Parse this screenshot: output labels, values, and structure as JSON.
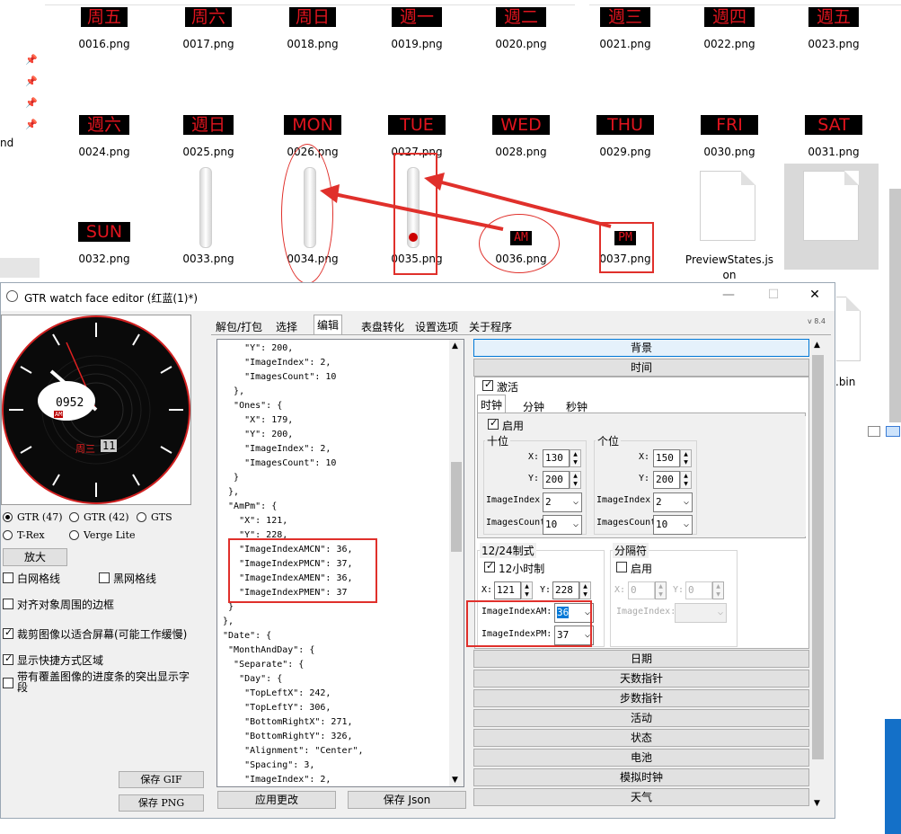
{
  "explorer": {
    "row1": [
      {
        "img": "周五",
        "file": "0016.png"
      },
      {
        "img": "周六",
        "file": "0017.png"
      },
      {
        "img": "周日",
        "file": "0018.png"
      },
      {
        "img": "週一",
        "file": "0019.png"
      },
      {
        "img": "週二",
        "file": "0020.png"
      },
      {
        "img": "週三",
        "file": "0021.png"
      },
      {
        "img": "週四",
        "file": "0022.png"
      },
      {
        "img": "週五",
        "file": "0023.png"
      }
    ],
    "row2": [
      {
        "img": "週六",
        "file": "0024.png"
      },
      {
        "img": "週日",
        "file": "0025.png"
      },
      {
        "img": "MON",
        "file": "0026.png"
      },
      {
        "img": "TUE",
        "file": "0027.png"
      },
      {
        "img": "WED",
        "file": "0028.png"
      },
      {
        "img": "THU",
        "file": "0029.png"
      },
      {
        "img": "FRI",
        "file": "0030.png"
      },
      {
        "img": "SAT",
        "file": "0031.png"
      }
    ],
    "row3": [
      {
        "img": "SUN",
        "file": "0032.png"
      },
      {
        "img": "",
        "file": "0033.png"
      },
      {
        "img": "",
        "file": "0034.png"
      },
      {
        "img": "",
        "file": "0035.png"
      },
      {
        "img": "AM",
        "file": "0036.png"
      },
      {
        "img": "PM",
        "file": "0037.png"
      },
      {
        "img": "",
        "file": "PreviewStates.json"
      },
      {
        "img": "",
        "file": "红蓝(1).json"
      }
    ],
    "left_edge_text": "nd",
    "partial_file": ".bin"
  },
  "window": {
    "title": "GTR watch face editor (红蓝(1)*)",
    "controls": {
      "min": "—",
      "max": "☐",
      "close": "✕"
    },
    "version": "v 8.4"
  },
  "preview": {
    "time": "0952",
    "ampm": "AM",
    "weekday": "周三",
    "day": "11"
  },
  "left": {
    "models": [
      "GTR (47)",
      "GTR (42)",
      "GTS",
      "T-Rex",
      "Verge Lite"
    ],
    "zoom_button": "放大",
    "checks": [
      {
        "label": "白网格线",
        "checked": false
      },
      {
        "label": "黑网格线",
        "checked": false
      },
      {
        "label": "对齐对象周围的边框",
        "checked": false
      },
      {
        "label": "裁剪图像以适合屏幕(可能工作缓慢)",
        "checked": true
      },
      {
        "label": "显示快捷方式区域",
        "checked": true
      },
      {
        "label": "带有覆盖图像的进度条的突出显示字段",
        "checked": false
      }
    ],
    "save_gif": "保存 GIF",
    "save_png": "保存 PNG"
  },
  "tabs": [
    "解包/打包",
    "选择",
    "编辑",
    "表盘转化",
    "设置选项",
    "关于程序"
  ],
  "json_text": "     \"Y\": 200,\n     \"ImageIndex\": 2,\n     \"ImagesCount\": 10\n   },\n   \"Ones\": {\n     \"X\": 179,\n     \"Y\": 200,\n     \"ImageIndex\": 2,\n     \"ImagesCount\": 10\n   }\n  },\n  \"AmPm\": {\n    \"X\": 121,\n    \"Y\": 228,\n    \"ImageIndexAMCN\": 36,\n    \"ImageIndexPMCN\": 37,\n    \"ImageIndexAMEN\": 36,\n    \"ImageIndexPMEN\": 37\n  }\n },\n \"Date\": {\n  \"MonthAndDay\": {\n   \"Separate\": {\n    \"Day\": {\n     \"TopLeftX\": 242,\n     \"TopLeftY\": 306,\n     \"BottomRightX\": 271,\n     \"BottomRightY\": 326,\n     \"Alignment\": \"Center\",\n     \"Spacing\": 3,\n     \"ImageIndex\": 2,",
  "apply_button": "应用更改",
  "save_json_button": "保存 Json",
  "sections": {
    "background": "背景",
    "time": "时间",
    "date": "日期",
    "days_pointer": "天数指针",
    "steps_pointer": "步数指针",
    "activity": "活动",
    "status": "状态",
    "battery": "电池",
    "analog": "模拟时钟",
    "weather": "天气"
  },
  "time_panel": {
    "activate": "激活",
    "subtabs": [
      "时钟",
      "分钟",
      "秒钟"
    ],
    "enable": "启用",
    "tens": {
      "title": "十位",
      "x": "130",
      "y": "200",
      "image_index": "2",
      "images_count": "10"
    },
    "ones": {
      "title": "个位",
      "x": "150",
      "y": "200",
      "image_index": "2",
      "images_count": "10"
    },
    "lbl_x": "X:",
    "lbl_y": "Y:",
    "lbl_image_index": "ImageIndex",
    "lbl_images_count": "ImagesCount",
    "ampm_group": {
      "title": "12/24制式",
      "check": "12小时制",
      "x": "121",
      "y": "228",
      "lbl_am": "ImageIndexAM:",
      "lbl_pm": "ImageIndexPM:",
      "am": "36",
      "pm": "37"
    },
    "separator": {
      "title": "分隔符",
      "enable": "启用",
      "x": "0",
      "y": "0",
      "lbl_image_index": "ImageIndex:"
    }
  }
}
